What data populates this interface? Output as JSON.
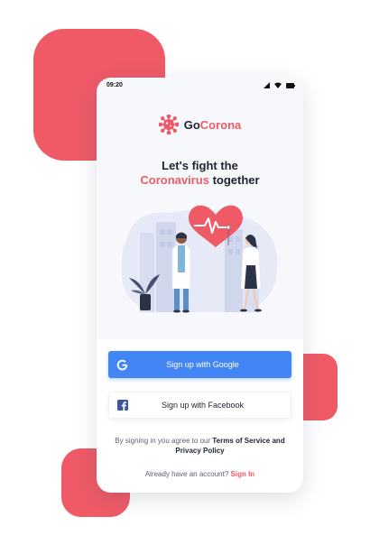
{
  "status_bar": {
    "time": "09:20"
  },
  "brand": {
    "part1": "Go",
    "part2": "Corona"
  },
  "headline": {
    "line1": "Let's fight the",
    "accent": "Coronavirus",
    "line2_rest": " together"
  },
  "buttons": {
    "google_label": "Sign up with Google",
    "facebook_label": "Sign up with Facebook"
  },
  "terms": {
    "prefix": "By signing in you agree to our ",
    "link": "Terms of Service and Privacy Policy"
  },
  "signin": {
    "prompt": "Already have an account? ",
    "link": "Sign In"
  },
  "colors": {
    "accent": "#ef5a66",
    "google_blue": "#4285f4",
    "facebook_blue": "#3b5998",
    "text_dark": "#1d2430"
  }
}
